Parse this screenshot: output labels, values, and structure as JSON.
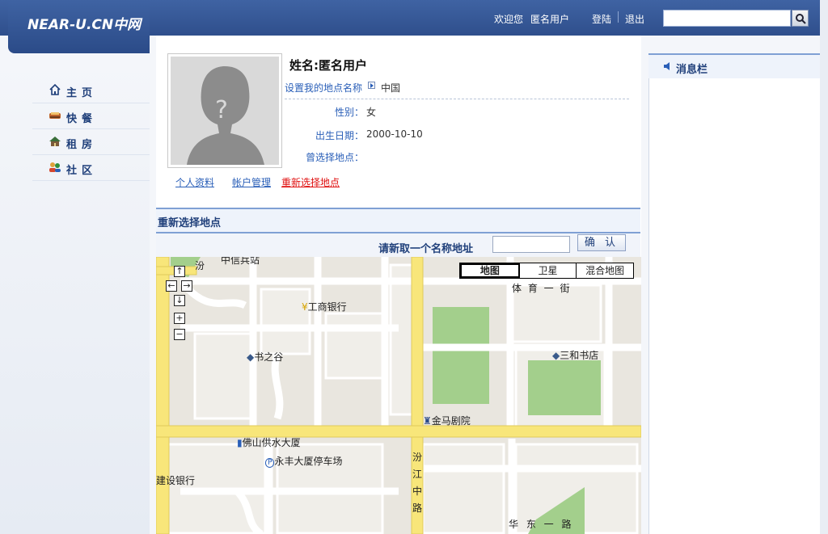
{
  "header": {
    "logo": "NEAR-U.CN",
    "logo_cn": "中网",
    "welcome": "欢迎您",
    "username": "匿名用户",
    "login": "登陆",
    "logout": "退出",
    "search_value": ""
  },
  "sidebar": {
    "items": [
      {
        "label": "主页",
        "icon": "home-icon"
      },
      {
        "label": "快餐",
        "icon": "food-icon"
      },
      {
        "label": "租房",
        "icon": "house-icon"
      },
      {
        "label": "社区",
        "icon": "community-icon"
      }
    ]
  },
  "profile": {
    "name_label": "姓名:",
    "name_value": "匿名用户",
    "set_location_link": "设置我的地点名称",
    "country": "中国",
    "gender_label": "性别：",
    "gender_value": "女",
    "birth_label": "出生日期：",
    "birth_value": "2000-10-10",
    "prev_location_label": "曾选择地点：",
    "prev_location_value": ""
  },
  "tabs": [
    {
      "label": "个人资料"
    },
    {
      "label": "帐户管理"
    },
    {
      "label": "重新选择地点"
    }
  ],
  "reselect": {
    "title": "重新选择地点",
    "rename_label": "请新取一个名称地址",
    "rename_value": "",
    "confirm": "确 认"
  },
  "map": {
    "types": [
      "地图",
      "卫星",
      "混合地图"
    ],
    "selected_type": "地图",
    "labels": {
      "top_partial": "汾",
      "top_road": "中信兵站",
      "road_tiyu": "体 育 一 街",
      "bank_icbc": "工商银行",
      "shuzhigu": "书之谷",
      "sanhe": "三和书店",
      "jinma": "金马剧院",
      "foshan_water": "佛山供水大厦",
      "parking": "永丰大厦停车场",
      "ccb": "建设银行",
      "fenjiang_road": "汾江中路",
      "bottom_road": "华 东 一 路"
    }
  },
  "right_panel": {
    "title": "消息栏"
  }
}
